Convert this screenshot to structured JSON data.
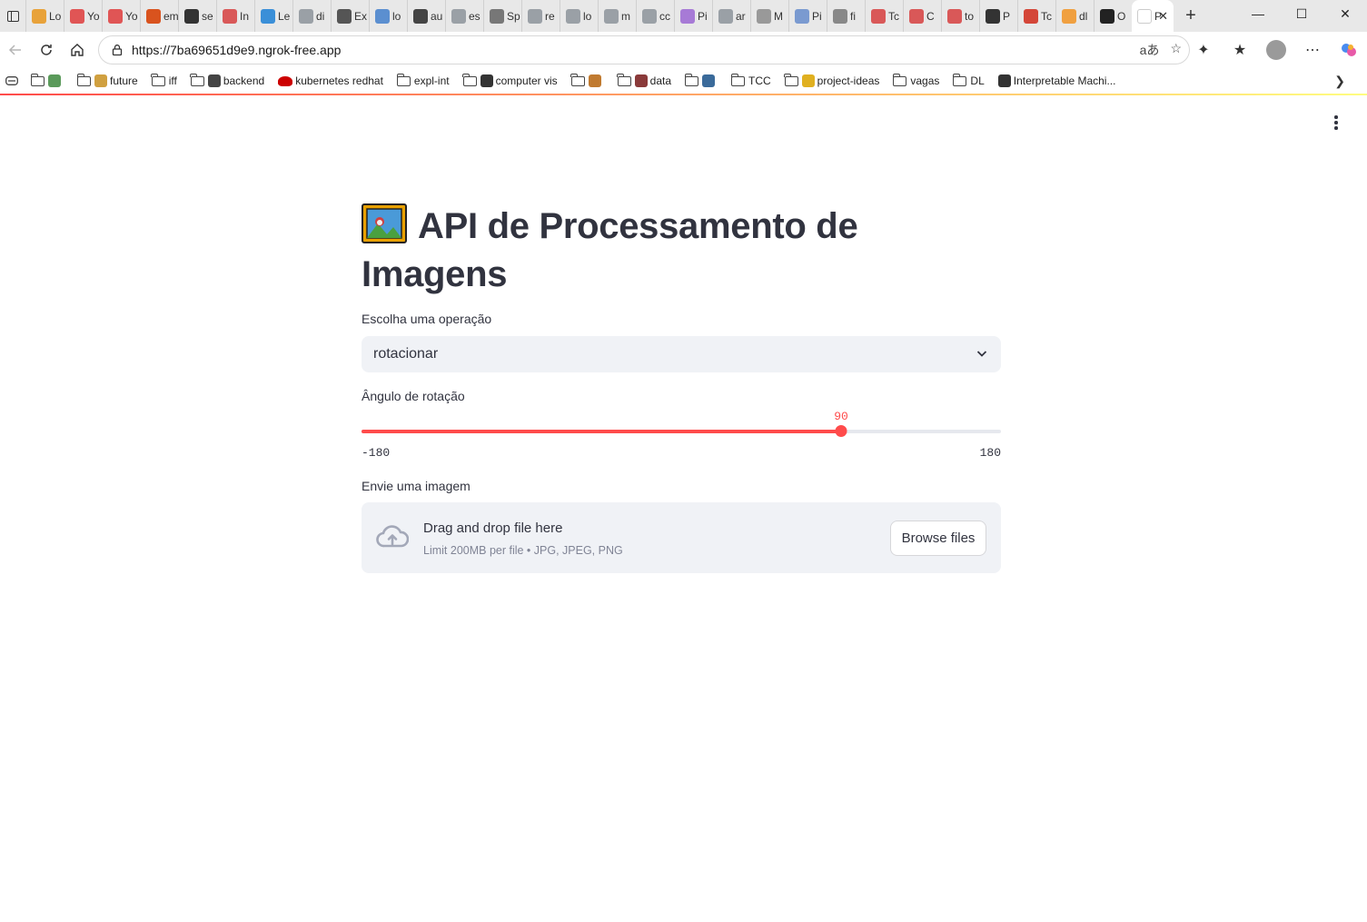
{
  "browser": {
    "tabs": [
      {
        "label": "Lo",
        "icon": "colorful-icon",
        "color": "#e8a23a"
      },
      {
        "label": "Yo",
        "icon": "youtube-icon",
        "color": "#e05555"
      },
      {
        "label": "Yo",
        "icon": "youtube-icon",
        "color": "#e05555"
      },
      {
        "label": "em",
        "icon": "em-icon",
        "color": "#d9531e"
      },
      {
        "label": "se",
        "icon": "github-icon",
        "color": "#333333"
      },
      {
        "label": "In",
        "icon": "pdf-icon",
        "color": "#d95858"
      },
      {
        "label": "Le",
        "icon": "k-icon",
        "color": "#3a8fd8"
      },
      {
        "label": "di",
        "icon": "google-icon",
        "color": "#9aa0a6"
      },
      {
        "label": "Ex",
        "icon": "m-icon",
        "color": "#555555"
      },
      {
        "label": "lo",
        "icon": "docker-icon",
        "color": "#5b8fd0"
      },
      {
        "label": "au",
        "icon": "camera-icon",
        "color": "#444444"
      },
      {
        "label": "es",
        "icon": "google-icon",
        "color": "#9aa0a6"
      },
      {
        "label": "Sp",
        "icon": "spotify-icon",
        "color": "#777777"
      },
      {
        "label": "re",
        "icon": "google-icon",
        "color": "#9aa0a6"
      },
      {
        "label": "lo",
        "icon": "google-icon",
        "color": "#9aa0a6"
      },
      {
        "label": "m",
        "icon": "google-icon",
        "color": "#9aa0a6"
      },
      {
        "label": "cc",
        "icon": "google-icon",
        "color": "#9aa0a6"
      },
      {
        "label": "Pi",
        "icon": "u-icon",
        "color": "#a77ad6"
      },
      {
        "label": "ar",
        "icon": "google-icon",
        "color": "#9aa0a6"
      },
      {
        "label": "M",
        "icon": "grid-icon",
        "color": "#999999"
      },
      {
        "label": "Pi",
        "icon": "dots-icon",
        "color": "#7a9ad0"
      },
      {
        "label": "fi",
        "icon": "github-icon",
        "color": "#888888"
      },
      {
        "label": "Tc",
        "icon": "pdf-icon",
        "color": "#d95858"
      },
      {
        "label": "C",
        "icon": "gmail-icon",
        "color": "#d95858"
      },
      {
        "label": "to",
        "icon": "pdf-icon",
        "color": "#d95858"
      },
      {
        "label": "P",
        "icon": "openai-icon",
        "color": "#333333"
      },
      {
        "label": "Tc",
        "icon": "gmail-icon",
        "color": "#d44638"
      },
      {
        "label": "dl",
        "icon": "orange-icon",
        "color": "#f0a040"
      },
      {
        "label": "O",
        "icon": "github-icon",
        "color": "#222222"
      },
      {
        "label": "P",
        "icon": "streamlit-icon",
        "color": "#ffffff"
      }
    ],
    "url": "https://7ba69651d9e9.ngrok-free.app",
    "bookmarks": [
      {
        "label": "",
        "type": "folder-emoji",
        "emoji_color": "#5a9a5a"
      },
      {
        "label": "future",
        "type": "folder-emoji",
        "emoji_color": "#d0a040"
      },
      {
        "label": "iff",
        "type": "folder"
      },
      {
        "label": "backend",
        "type": "folder-emoji",
        "emoji_color": "#444444"
      },
      {
        "label": "kubernetes redhat",
        "type": "redhat",
        "emoji_color": "#cc0000"
      },
      {
        "label": "expl-int",
        "type": "folder"
      },
      {
        "label": "computer vis",
        "type": "folder-emoji",
        "emoji_color": "#333333"
      },
      {
        "label": "",
        "type": "folder-emoji",
        "emoji_color": "#c07a30"
      },
      {
        "label": "data",
        "type": "folder-emoji",
        "emoji_color": "#8a3a3a"
      },
      {
        "label": "",
        "type": "folder-emoji",
        "emoji_color": "#3a6a9a"
      },
      {
        "label": "TCC",
        "type": "folder"
      },
      {
        "label": "project-ideas",
        "type": "folder-emoji",
        "emoji_color": "#e0b020"
      },
      {
        "label": "vagas",
        "type": "folder"
      },
      {
        "label": "DL",
        "type": "folder"
      },
      {
        "label": "Interpretable Machi...",
        "type": "site",
        "emoji_color": "#333333"
      }
    ]
  },
  "app": {
    "title": "API de Processamento de Imagens",
    "title_emoji": "framed-picture-icon",
    "operation": {
      "label": "Escolha uma operação",
      "selected": "rotacionar"
    },
    "angle_slider": {
      "label": "Ângulo de rotação",
      "min": -180,
      "max": 180,
      "value": 90,
      "min_label": "-180",
      "max_label": "180",
      "value_label": "90"
    },
    "upload": {
      "label": "Envie uma imagem",
      "drop_text": "Drag and drop file here",
      "limit_text": "Limit 200MB per file • JPG, JPEG, PNG",
      "browse_label": "Browse files"
    }
  },
  "colors": {
    "accent": "#ff4b4b",
    "text": "#31333f",
    "widget_bg": "#f0f2f6"
  }
}
